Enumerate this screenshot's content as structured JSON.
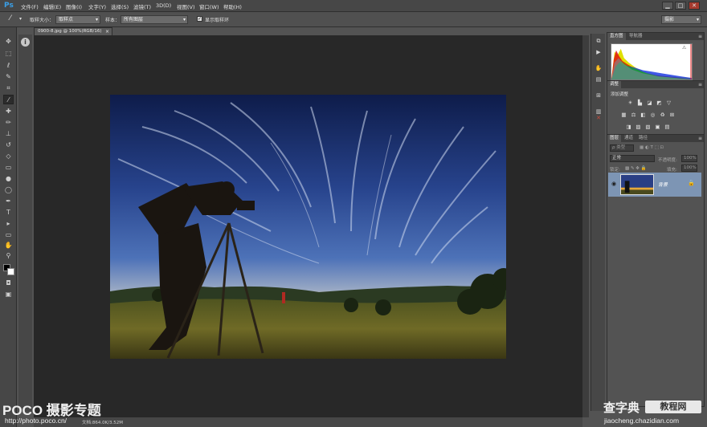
{
  "app": {
    "logo": "Ps"
  },
  "menu": [
    "文件(F)",
    "编辑(E)",
    "图像(I)",
    "文字(Y)",
    "选择(S)",
    "滤镜(T)",
    "3D(D)",
    "视图(V)",
    "窗口(W)",
    "帮助(H)"
  ],
  "window_controls": {
    "minimize": "▁",
    "maximize": "□",
    "close": "✕"
  },
  "options_bar": {
    "tool_icon": "eyedropper-icon",
    "sample_size_label": "取样大小：",
    "sample_size_value": "取样点",
    "sample_label": "样本：",
    "sample_value": "所有图层",
    "show_ring_checked": true,
    "show_ring_label": "显示取样环",
    "workspace_value": "摄影"
  },
  "document": {
    "tab_title": "0900-8.jpg @ 100%(RGB/16)",
    "tab_close": "×",
    "status_text": "文档:864.0K/3.52M"
  },
  "panels": {
    "histogram": {
      "tabs": [
        "直方图",
        "导航器"
      ],
      "warning": "⚠"
    },
    "adjustments": {
      "tab": "调整",
      "title": "添加调整"
    },
    "layers": {
      "tabs": [
        "图层",
        "通道",
        "路径"
      ],
      "kind_filter": "ρ 类型",
      "blend_mode": "正常",
      "opacity_label": "不透明度:",
      "opacity_value": "100%",
      "lock_label": "锁定:",
      "fill_label": "填充:",
      "fill_value": "100%",
      "layer_name": "背景"
    }
  },
  "watermarks": {
    "poco_title": "POCO 摄影专题",
    "poco_url": "http://photo.poco.cn/",
    "cz_title": "查字典",
    "cz_badge": "教程网",
    "cz_url": "jiaocheng.chazidian.com"
  },
  "colors": {
    "accent": "#3aa0e8",
    "layer_selected": "#7d95b4",
    "canvas_bg": "#282828"
  }
}
